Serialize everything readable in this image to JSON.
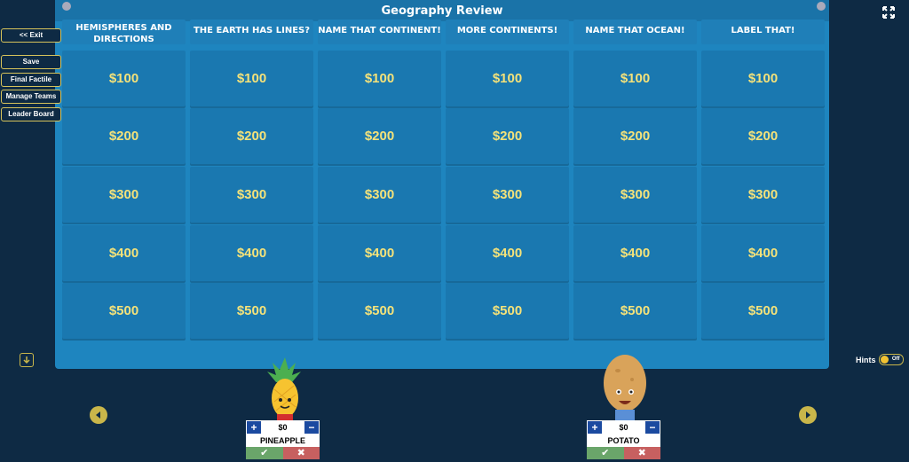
{
  "title": "Geography Review",
  "categories": [
    "HEMISPHERES AND DIRECTIONS",
    "THE EARTH HAS LINES?",
    "NAME THAT CONTINENT!",
    "MORE CONTINENTS!",
    "NAME THAT OCEAN!",
    "LABEL THAT!"
  ],
  "values": [
    "$100",
    "$200",
    "$300",
    "$400",
    "$500"
  ],
  "sidebar": {
    "exit": "<< Exit",
    "save": "Save",
    "final": "Final Factile",
    "manage": "Manage Teams",
    "leader": "Leader Board"
  },
  "teams": [
    {
      "name": "PINEAPPLE",
      "score": "$0"
    },
    {
      "name": "POTATO",
      "score": "$0"
    }
  ],
  "hints": {
    "label": "Hints",
    "state": "Off"
  },
  "colors": {
    "board": "#1e85bf",
    "cell": "#1a78b0",
    "value_text": "#f4e27a",
    "background": "#0e2a44",
    "accent": "#c9b64a"
  }
}
